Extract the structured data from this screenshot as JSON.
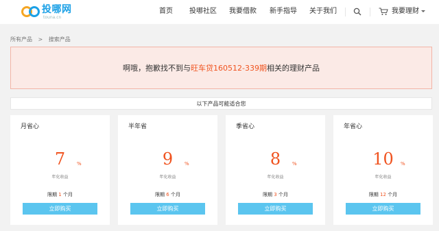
{
  "logo": {
    "name": "投哪网",
    "sub": "touna.cn"
  },
  "nav": {
    "items": [
      "首页",
      "投哪社区",
      "我要借款",
      "新手指导",
      "关于我们"
    ],
    "my_finance": "我要理财"
  },
  "breadcrumb": {
    "root": "所有产品",
    "separator": ">",
    "current": "搜索产品"
  },
  "alert": {
    "prefix": "啊哦，抱歉找不到与",
    "keyword": "旺车贷160512-339期",
    "suffix": "相关的理财产品"
  },
  "suggest_bar": "以下产品可能适合您",
  "cards": [
    {
      "title": "月省心",
      "rate": "7",
      "pct": "%",
      "rate_label": "年化收益",
      "term_prefix": "限期",
      "term_num": "1",
      "term_unit": "个月",
      "button": "立即购买"
    },
    {
      "title": "半年省",
      "rate": "9",
      "pct": "%",
      "rate_label": "年化收益",
      "term_prefix": "限期",
      "term_num": "6",
      "term_unit": "个月",
      "button": "立即购买"
    },
    {
      "title": "季省心",
      "rate": "8",
      "pct": "%",
      "rate_label": "年化收益",
      "term_prefix": "限期",
      "term_num": "3",
      "term_unit": "个月",
      "button": "立即购买"
    },
    {
      "title": "年省心",
      "rate": "10",
      "pct": "%",
      "rate_label": "年化收益",
      "term_prefix": "限期",
      "term_num": "12",
      "term_unit": "个月",
      "button": "立即购买"
    }
  ],
  "colors": {
    "brand": "#1aa0e6",
    "accent": "#f0531f",
    "button": "#5bc5ef",
    "alert_bg": "#fbeae6"
  }
}
